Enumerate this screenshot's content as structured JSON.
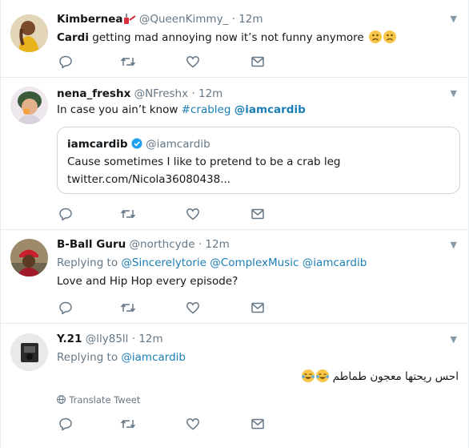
{
  "tweets": [
    {
      "name": "Kimbernea",
      "handle": "@QueenKimmy_",
      "time": "12m",
      "text_bold": "Cardi",
      "text_rest": " getting mad annoying now it’s not funny anymore",
      "emoji": [
        "frowning-emoji",
        "frowning-emoji"
      ]
    },
    {
      "name": "nena_freshx",
      "handle": "@NFreshx",
      "time": "12m",
      "text_plain": "In case you ain’t know ",
      "hashtag": "#crableg",
      "mention": "@iamcardib",
      "quote": {
        "name": "iamcardib",
        "handle": "@iamcardib",
        "text": "Cause sometimes I like to pretend to be a crab leg",
        "link": "twitter.com/Nicola36080438..."
      }
    },
    {
      "name": "B-Ball Guru",
      "handle": "@northcyde",
      "time": "12m",
      "replying_label": "Replying to",
      "replying_to": [
        "@Sincerelytorie",
        "@ComplexMusic",
        "@iamcardib"
      ],
      "text": "Love and Hip Hop every episode?"
    },
    {
      "name": "Y.21",
      "handle": "@lly85ll",
      "time": "12m",
      "replying_label": "Replying to",
      "replying_to": [
        "@iamcardib"
      ],
      "text": "احس ريحتها معجون طماطم",
      "emoji": [
        "tears-of-joy-emoji",
        "tears-of-joy-emoji"
      ],
      "translate_label": "Translate Tweet"
    }
  ],
  "dot": "·",
  "colors": {
    "link": "#1b7eb4",
    "secondary_text": "#657786",
    "icon": "#657786",
    "border": "#e6ecf0",
    "verified": "#1da1f2"
  }
}
